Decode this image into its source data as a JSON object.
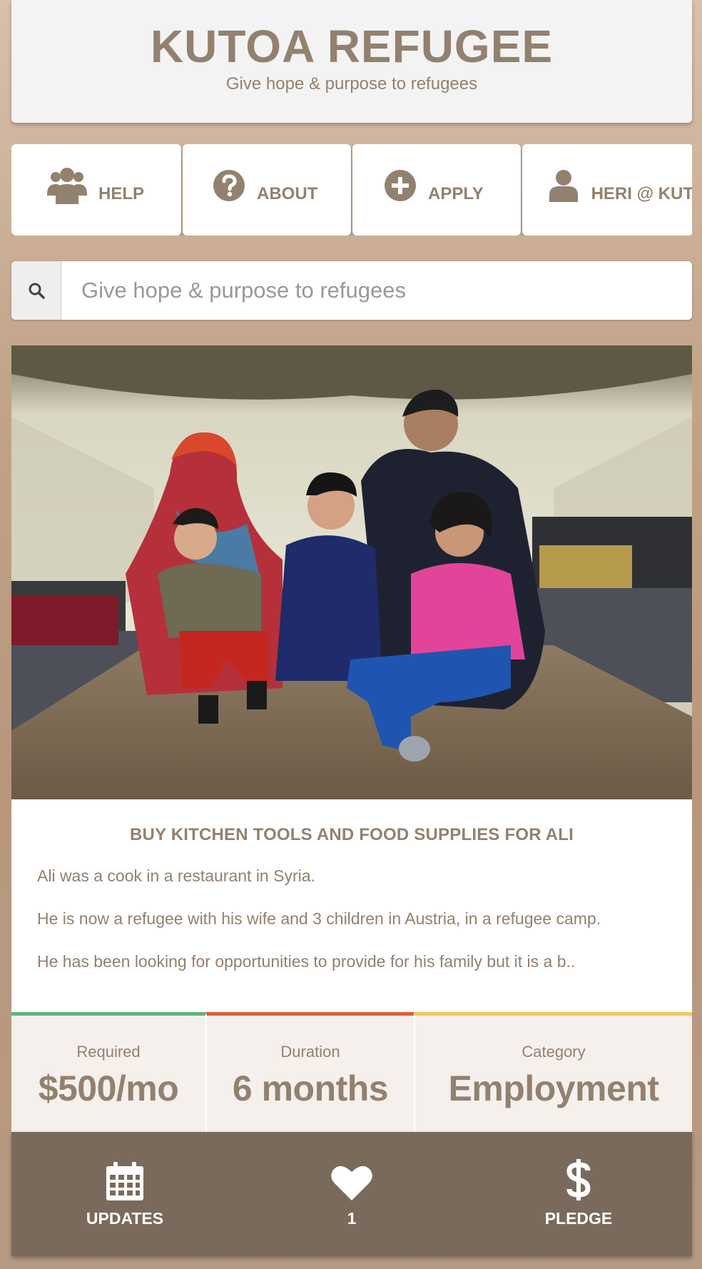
{
  "header": {
    "title": "KUTOA REFUGEE",
    "subtitle": "Give hope & purpose to refugees"
  },
  "nav": {
    "items": [
      {
        "label": "HELP",
        "icon": "users-icon"
      },
      {
        "label": "ABOUT",
        "icon": "question-circle-icon"
      },
      {
        "label": "APPLY",
        "icon": "plus-circle-icon"
      },
      {
        "label": "HERI @ KUT",
        "icon": "user-icon"
      }
    ]
  },
  "search": {
    "placeholder": "Give hope & purpose to refugees",
    "icon": "search-icon"
  },
  "story": {
    "image": "family-in-tent-photo",
    "title": "BUY KITCHEN TOOLS AND FOOD SUPPLIES FOR ALI",
    "paragraphs": [
      "Ali was a cook in a restaurant in Syria.",
      "He is now a refugee with his wife and 3 children in Austria, in a refugee camp.",
      "He has been looking for opportunities to provide for his family but it is a b.."
    ]
  },
  "stats": [
    {
      "label": "Required",
      "value": "$500/mo",
      "color": "#5cb87a"
    },
    {
      "label": "Duration",
      "value": "6 months",
      "color": "#e05c3a"
    },
    {
      "label": "Category",
      "value": "Employment",
      "color": "#ecc95c"
    }
  ],
  "actions": [
    {
      "label": "UPDATES",
      "icon": "calendar-icon"
    },
    {
      "label": "1",
      "icon": "heart-icon"
    },
    {
      "label": "PLEDGE",
      "icon": "dollar-icon"
    }
  ],
  "colors": {
    "brand_text": "#93816f",
    "action_bar": "#7a6a5c"
  }
}
